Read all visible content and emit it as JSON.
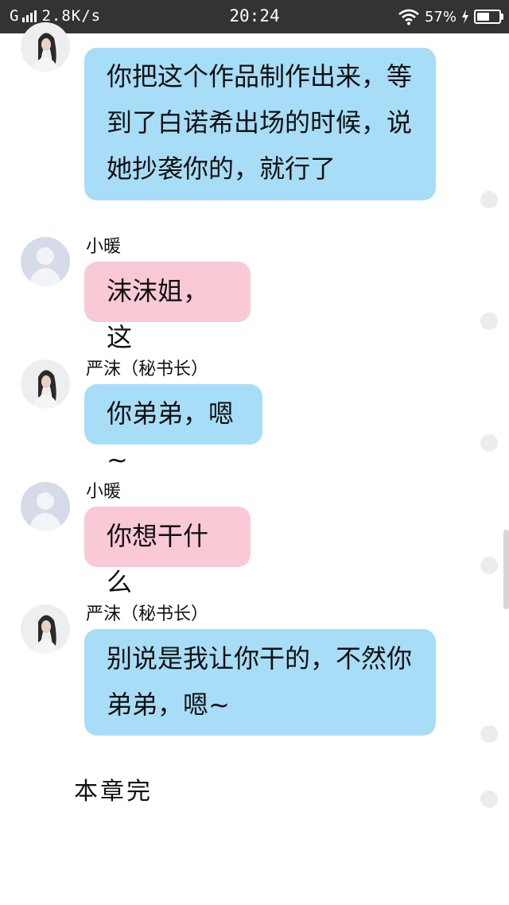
{
  "status_bar": {
    "network": "G",
    "speed": "2.8K/s",
    "time": "20:24",
    "battery_percent": "57%",
    "battery_level": 0.57,
    "icons": [
      "signal-icon",
      "wifi-icon",
      "charging-icon",
      "battery-icon"
    ]
  },
  "colors": {
    "status_bar": "#333333",
    "self_bubble": "#a8ddf7",
    "other_bubble": "#f9c9d6",
    "background": "#ffffff"
  },
  "messages": [
    {
      "sender": "",
      "lines": [
        "你把这个作品制作出来，等",
        "到了白诺希出场的时候，说",
        "她抄袭你的，就行了"
      ],
      "avatar": "woman-avatar"
    },
    {
      "sender": "小暖",
      "lines": [
        "沫沫姐，这"
      ],
      "avatar": "default-avatar"
    },
    {
      "sender": "严沫（秘书长）",
      "lines": [
        "你弟弟，嗯~"
      ],
      "avatar": "woman-avatar"
    },
    {
      "sender": "小暖",
      "lines": [
        "你想干什么"
      ],
      "avatar": "default-avatar"
    },
    {
      "sender": "严沫（秘书长）",
      "lines": [
        "别说是我让你干的，不然你",
        "弟弟，嗯~"
      ],
      "avatar": "woman-avatar"
    }
  ],
  "footer": {
    "chapter_end": "本章完"
  }
}
